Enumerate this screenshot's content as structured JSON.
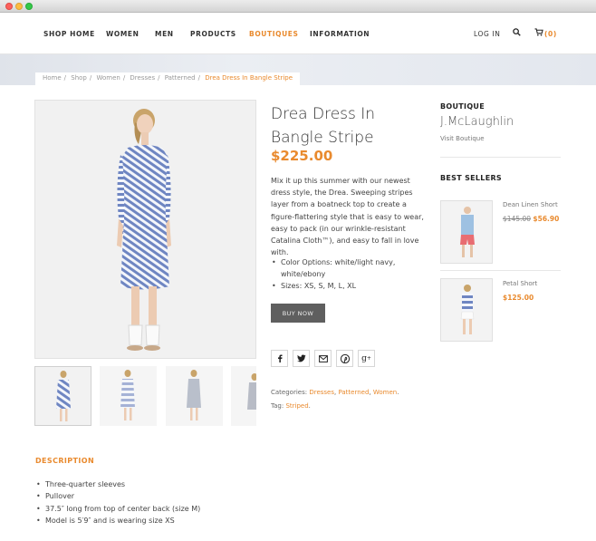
{
  "nav": {
    "items": [
      "SHOP HOME",
      "WOMEN",
      "MEN",
      "PRODUCTS",
      "BOUTIQUES",
      "INFORMATION"
    ],
    "active": "BOUTIQUES",
    "login": "LOG IN",
    "cart_count": "(0)"
  },
  "breadcrumb": [
    "Home",
    "Shop",
    "Women",
    "Dresses",
    "Patterned"
  ],
  "breadcrumb_current": "Drea Dress In Bangle Stripe",
  "product": {
    "title": "Drea Dress In Bangle Stripe",
    "price": "$225.00",
    "description": "Mix it up this summer with our newest dress style, the Drea. Sweeping stripes layer from a boatneck top to create a figure-flattering style that is easy to wear, easy to pack (in our wrinkle-resistant Catalina Cloth™), and easy to fall in love with.",
    "options": [
      "Color Options: white/light navy, white/ebony",
      "Sizes: XS, S, M, L, XL"
    ],
    "buy_label": "BUY NOW",
    "share_icons": [
      "facebook-icon",
      "twitter-icon",
      "mail-icon",
      "pinterest-icon",
      "google-plus-icon"
    ],
    "categories_label": "Categories:",
    "categories": [
      "Dresses",
      "Patterned",
      "Women"
    ],
    "tag_label": "Tag:",
    "tag": "Striped"
  },
  "sidebar": {
    "boutique_heading": "BOUTIQUE",
    "boutique_name": "J.McLaughlin",
    "visit_label": "Visit Boutique",
    "best_sellers_heading": "BEST SELLERS",
    "best_sellers": [
      {
        "name": "Dean Linen Short",
        "old_price": "$145.00",
        "price": "$56.90"
      },
      {
        "name": "Petal Short",
        "old_price": "",
        "price": "$125.00"
      }
    ]
  },
  "description": {
    "heading": "DESCRIPTION",
    "items": [
      "Three-quarter sleeves",
      "Pullover",
      "37.5″ long from top of center back (size M)",
      "Model is 5′9″ and is wearing size XS"
    ]
  },
  "colors": {
    "accent": "#e98a2e",
    "button": "#5f5f5f"
  }
}
